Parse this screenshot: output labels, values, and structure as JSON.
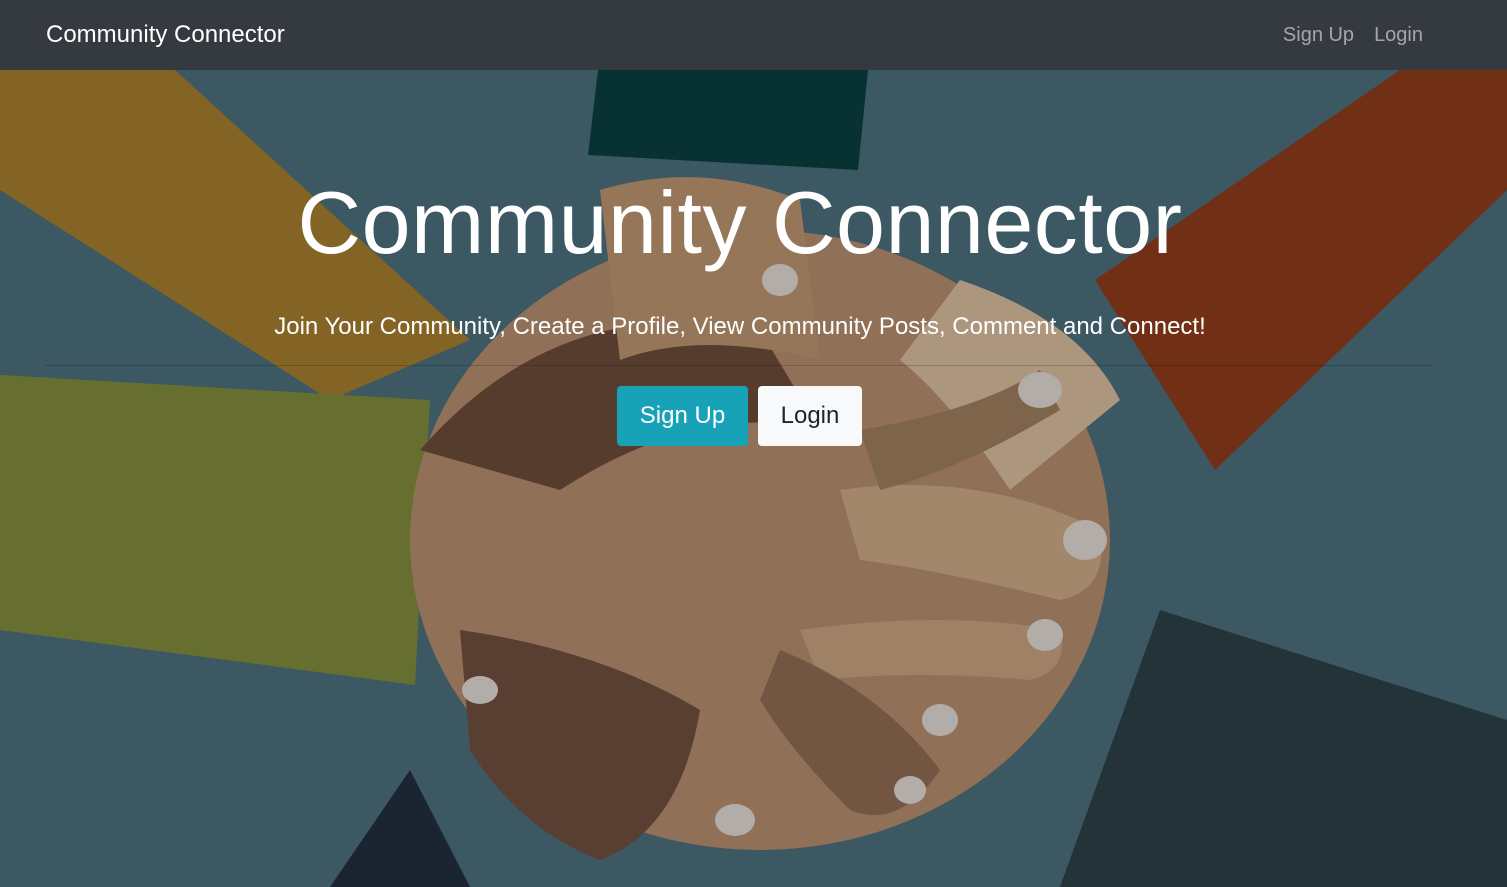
{
  "navbar": {
    "brand": "Community Connector",
    "links": [
      {
        "label": "Sign Up"
      },
      {
        "label": "Login"
      }
    ],
    "background": "#343a40"
  },
  "hero": {
    "title": "Community Connector",
    "lead": "Join Your Community, Create a Profile, View Community Posts, Comment and Connect!",
    "buttons": {
      "signup_label": "Sign Up",
      "login_label": "Login"
    },
    "background_image": "hands-stacked-illustration"
  },
  "colors": {
    "signup_button": "#17a2b8",
    "login_button": "#f8f9fa"
  }
}
